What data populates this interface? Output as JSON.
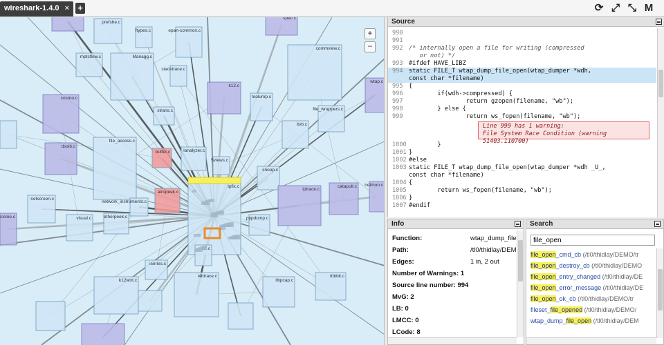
{
  "tab": {
    "title": "wireshark-1.4.0",
    "close": "×",
    "new_tab": "+"
  },
  "toolbar": {
    "icon_refresh": "⟳",
    "icon_expand": "⤢",
    "icon_collapse": "⤡",
    "icon_m": "M"
  },
  "graph": {
    "zoom_in": "+",
    "zoom_out": "−",
    "labels": [
      "ber.c",
      "prefshe.c",
      "ftypes.c",
      "epan-common.c",
      "spec.c",
      "mptcflow.c",
      "Managg.c",
      "stacktrace.c",
      "k12.c",
      "toolump.c",
      "commview.c",
      "cosmo.c",
      "strans.c",
      "itvb.c",
      "file_wrappers.c",
      "wtap.c",
      "dssib.c",
      "file_access.c",
      "buffer.c",
      "lanalyzer.c",
      "5views.c",
      "snoop.c",
      "ipfix.c",
      "airopeek.c",
      "network_instruments.c",
      "etherpeek.c",
      "visual.c",
      "netscreen.c",
      "cosine.c",
      "pppdump.c",
      "iptrace.c",
      "catapult.c",
      "netmon.c",
      "erf.c",
      "iseries.c",
      "k12text.c",
      "i4btrace.c",
      "libpcap.c",
      "rttbbit.c"
    ]
  },
  "source": {
    "header": "Source",
    "lines": [
      {
        "n": "990",
        "t": ""
      },
      {
        "n": "991",
        "t": ""
      },
      {
        "n": "992",
        "t": "/* internally open a file for writing (compressed"
      },
      {
        "n": "",
        "t": "   or not) */"
      },
      {
        "n": "993",
        "t": "#ifdef HAVE_LIBZ"
      },
      {
        "n": "994",
        "t": "static FILE_T wtap_dump_file_open(wtap_dumper *wdh,"
      },
      {
        "n": "",
        "t": "const char *filename)"
      },
      {
        "n": "995",
        "t": "{"
      },
      {
        "n": "996",
        "t": "        if(wdh->compressed) {"
      },
      {
        "n": "997",
        "t": "                return gzopen(filename, \"wb\");"
      },
      {
        "n": "998",
        "t": "        } else {"
      },
      {
        "n": "999",
        "t": "                return ws_fopen(filename, \"wb\");"
      },
      {
        "n": "1000",
        "t": "        }"
      },
      {
        "n": "1001",
        "t": "}"
      },
      {
        "n": "1002",
        "t": "#else"
      },
      {
        "n": "1003",
        "t": "static FILE_T wtap_dump_file_open(wtap_dumper *wdh _U_,"
      },
      {
        "n": "",
        "t": "const char *filename)"
      },
      {
        "n": "1004",
        "t": "{"
      },
      {
        "n": "1005",
        "t": "        return ws_fopen(filename, \"wb\");"
      },
      {
        "n": "1006",
        "t": "}"
      },
      {
        "n": "1007",
        "t": "#endif"
      }
    ],
    "warning_line1": "Line 999 has 1 warning:",
    "warning_line2": "File System Race Condition (warning 51403.110700)"
  },
  "info": {
    "header": "Info",
    "rows": [
      {
        "k": "Function:",
        "v": "wtap_dump_file"
      },
      {
        "k": "Path:",
        "v": "/tl0/thidlay/DEM"
      },
      {
        "k": "Edges:",
        "v": "1 in, 2 out"
      },
      {
        "k": "Number of Warnings: 1",
        "v": ""
      },
      {
        "k": "Source line number: 994",
        "v": ""
      },
      {
        "k": "MvG: 2",
        "v": ""
      },
      {
        "k": "LB: 0",
        "v": ""
      },
      {
        "k": "LMCC: 0",
        "v": ""
      },
      {
        "k": "LCode: 8",
        "v": ""
      }
    ]
  },
  "search": {
    "header": "Search",
    "query": "file_open",
    "results": [
      {
        "pre": "",
        "m": "file_open",
        "post": "_cmd_cb",
        "path": " (/tl0/thidlay/DEMO/tr"
      },
      {
        "pre": "",
        "m": "file_open",
        "post": "_destroy_cb",
        "path": " (/tl0/thidlay/DEMO"
      },
      {
        "pre": "",
        "m": "file_open",
        "post": "_entry_changed",
        "path": " (/tl0/thidlay/DE"
      },
      {
        "pre": "",
        "m": "file_open",
        "post": "_error_message",
        "path": " (/tl0/thidlay/DE"
      },
      {
        "pre": "",
        "m": "file_open",
        "post": "_ok_cb",
        "path": " (/tl0/thidlay/DEMO/tr"
      },
      {
        "pre": "fileset_",
        "m": "file_opened",
        "post": "",
        "path": " (/tl0/thidlay/DEMO/"
      },
      {
        "pre": "wtap_dump_",
        "m": "file_open",
        "post": "",
        "path": " (/tl0/thidlay/DEM"
      }
    ]
  },
  "colors": {
    "node_blue": "#cfe6f6",
    "node_purple": "#b9b9e6",
    "node_red": "#f19a9a",
    "selected": "#f08a24",
    "highlight": "#f6f05b"
  }
}
